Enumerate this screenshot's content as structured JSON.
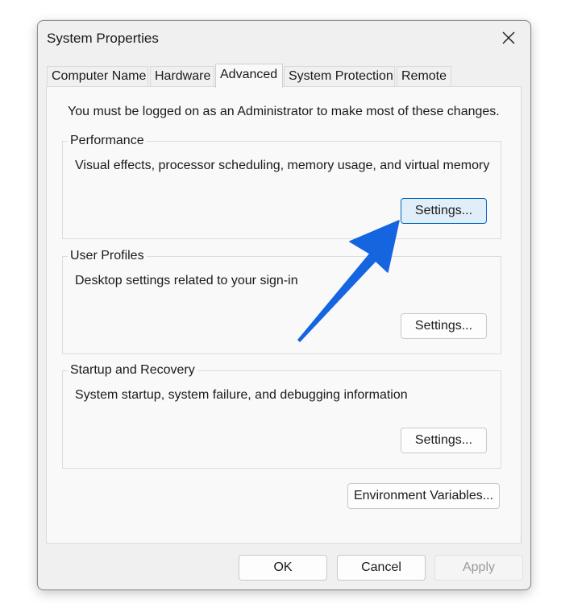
{
  "window": {
    "title": "System Properties"
  },
  "tabs": [
    {
      "label": "Computer Name",
      "active": false
    },
    {
      "label": "Hardware",
      "active": false
    },
    {
      "label": "Advanced",
      "active": true
    },
    {
      "label": "System Protection",
      "active": false
    },
    {
      "label": "Remote",
      "active": false
    }
  ],
  "advanced": {
    "admin_note": "You must be logged on as an Administrator to make most of these changes.",
    "performance": {
      "title": "Performance",
      "description": "Visual effects, processor scheduling, memory usage, and virtual memory",
      "button_label": "Settings..."
    },
    "user_profiles": {
      "title": "User Profiles",
      "description": "Desktop settings related to your sign-in",
      "button_label": "Settings..."
    },
    "startup_recovery": {
      "title": "Startup and Recovery",
      "description": "System startup, system failure, and debugging information",
      "button_label": "Settings..."
    },
    "env_vars_label": "Environment Variables..."
  },
  "footer": {
    "ok_label": "OK",
    "cancel_label": "Cancel",
    "apply_label": "Apply",
    "apply_enabled": false
  },
  "annotation": {
    "arrow_color": "#1565e0",
    "arrow_target": "performance-settings-button"
  },
  "colors": {
    "focus_border": "#0067c0",
    "focus_fill": "#e0eef9"
  }
}
